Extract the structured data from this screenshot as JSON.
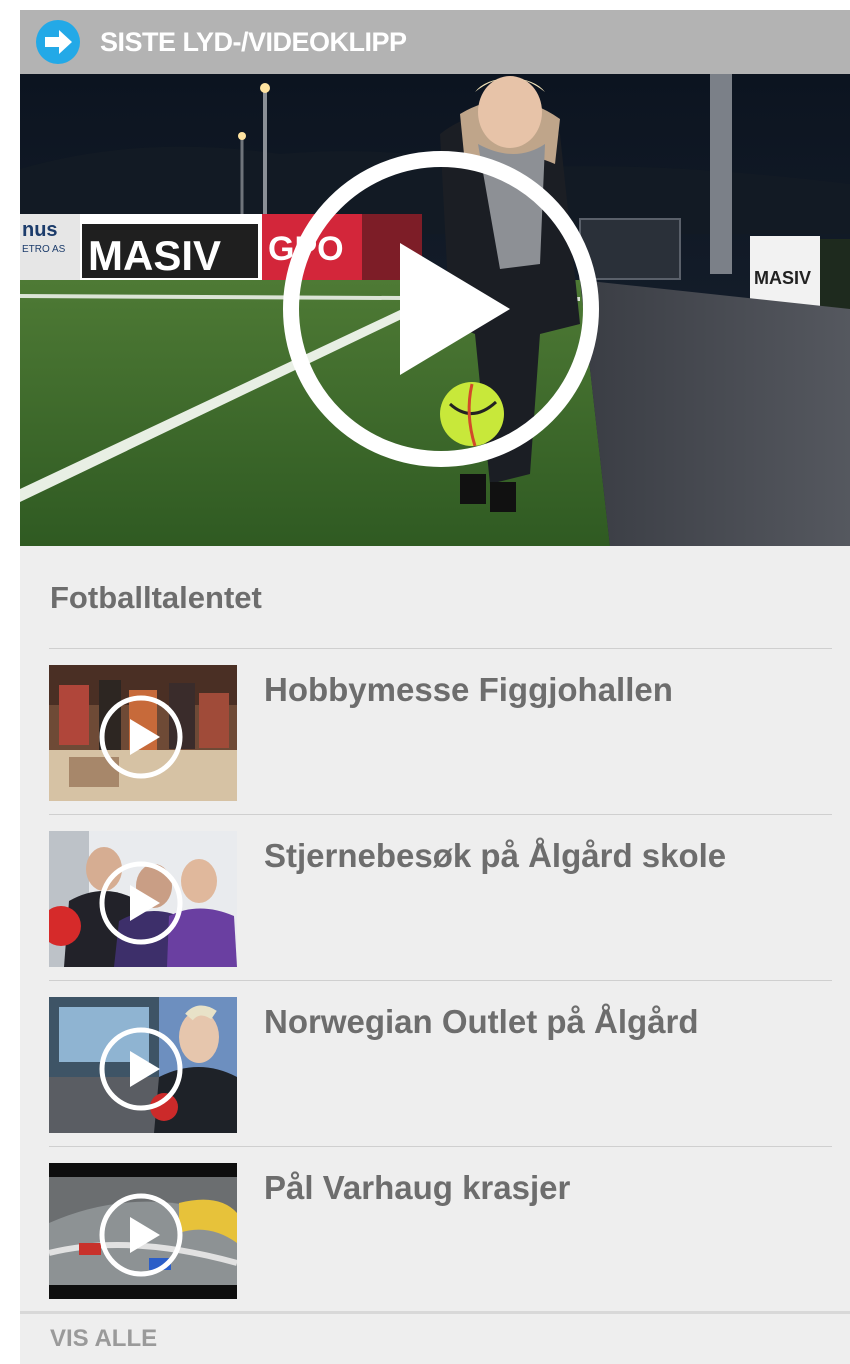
{
  "header": {
    "title": "SISTE LYD-/VIDEOKLIPP",
    "icon": "arrow-right-circle-icon",
    "accent_color": "#23a9e7"
  },
  "hero": {
    "banners": [
      "MASIV",
      "nus",
      "ETRO AS",
      "GPO",
      "MASIV"
    ],
    "play_icon": "play-circle-icon"
  },
  "featured": {
    "title": "Fotballtalentet"
  },
  "items": [
    {
      "title": "Hobbymesse Figgjohallen"
    },
    {
      "title": "Stjernebesøk på Ålgård skole"
    },
    {
      "title": "Norwegian Outlet på Ålgård"
    },
    {
      "title": "Pål Varhaug krasjer"
    }
  ],
  "footer": {
    "show_all_label": "VIS ALLE"
  }
}
